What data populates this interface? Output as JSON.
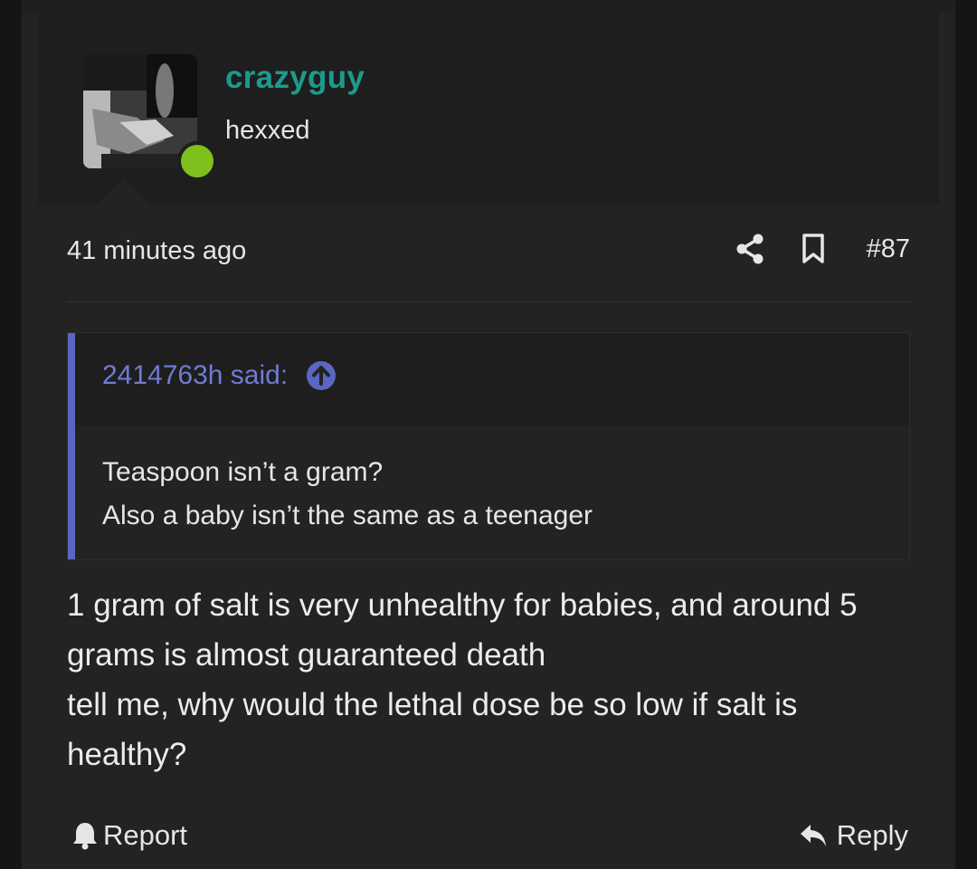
{
  "user": {
    "name": "crazyguy",
    "title": "hexxed",
    "status": "online"
  },
  "meta": {
    "time": "41 minutes ago",
    "post_number": "#87"
  },
  "quote": {
    "author_line": "2414763h said:",
    "lines": [
      "Teaspoon isn’t a gram?",
      "Also a baby isn’t the same as a teenager"
    ]
  },
  "message": {
    "paragraphs": [
      "1 gram of salt is very unhealthy for babies, and around 5 grams is almost guaranteed death",
      "tell me, why would the lethal dose be so low if salt is healthy?"
    ]
  },
  "footer": {
    "report_label": "Report",
    "reply_label": "Reply"
  },
  "colors": {
    "username": "#1c9b8c",
    "online": "#7fc01d",
    "quote_accent": "#5b66c2",
    "background": "#232323"
  },
  "icons": [
    "share-icon",
    "bookmark-icon",
    "jump-up-icon",
    "bell-icon",
    "reply-icon"
  ]
}
